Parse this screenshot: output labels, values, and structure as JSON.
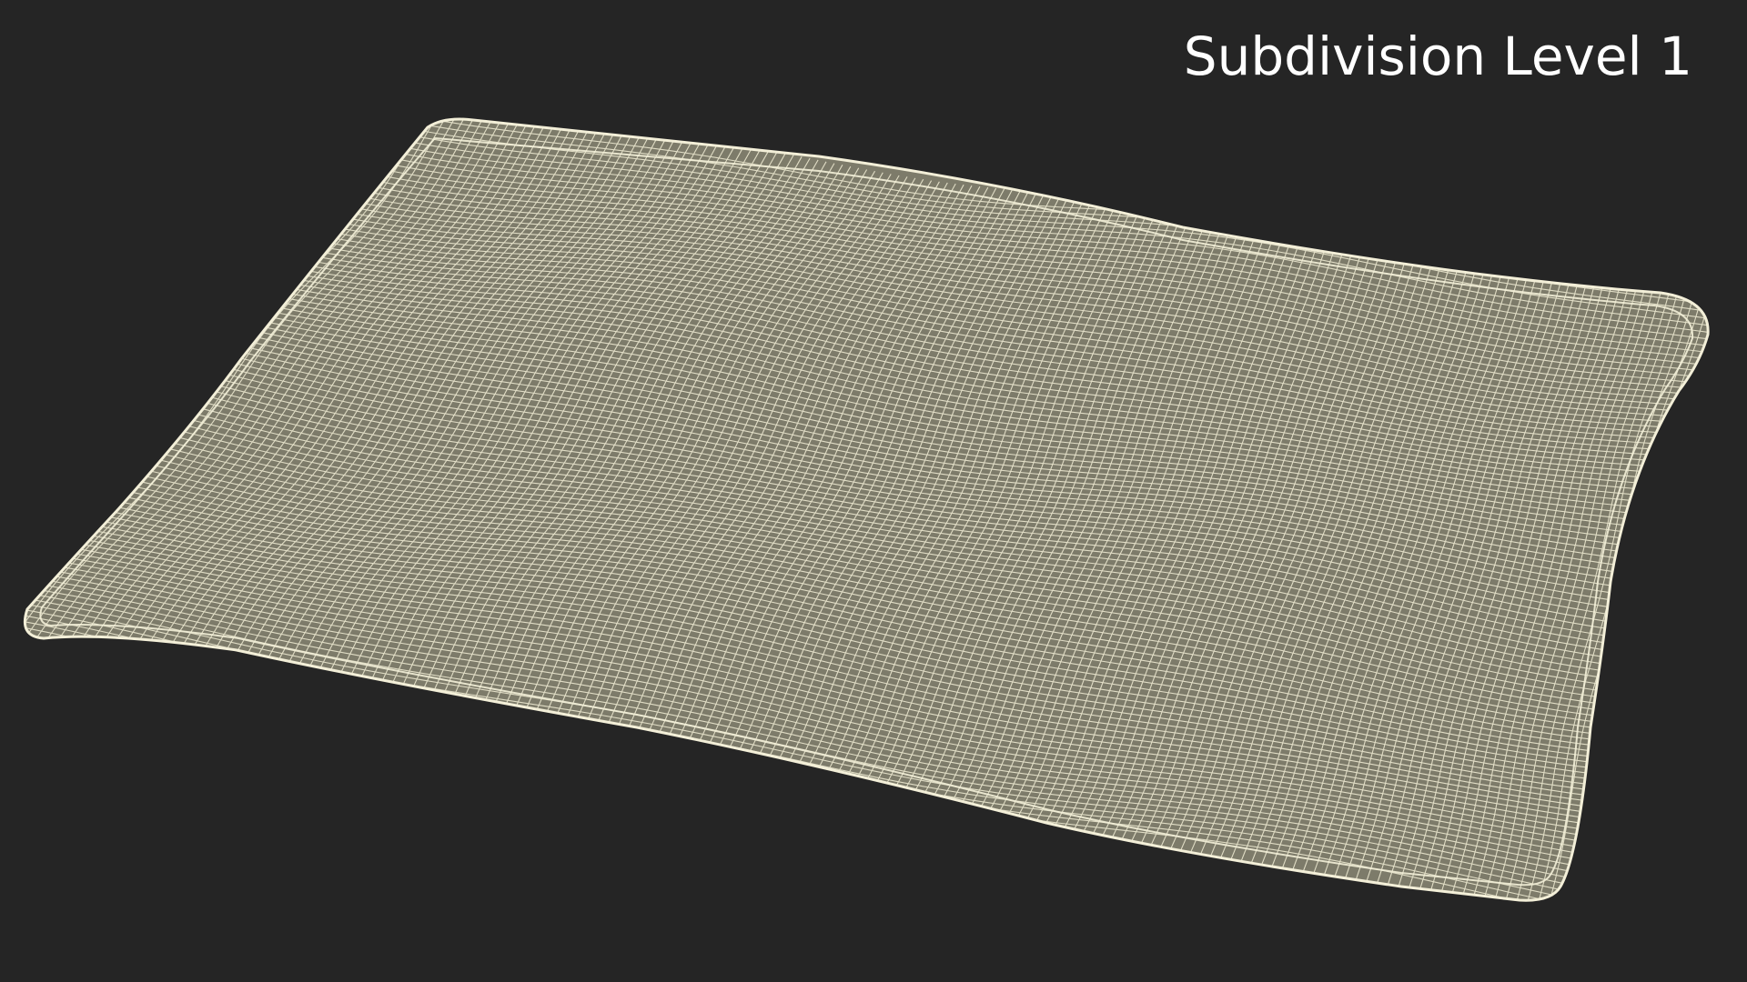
{
  "caption": {
    "text": "Subdivision Level 1"
  },
  "colors": {
    "background": "#252525",
    "surface_fill": "#7d7b6a",
    "wire": "#f0ecd6",
    "caption_text": "#ffffff"
  },
  "model": {
    "object": "pillow",
    "render_mode": "wireframe-over-shaded"
  }
}
